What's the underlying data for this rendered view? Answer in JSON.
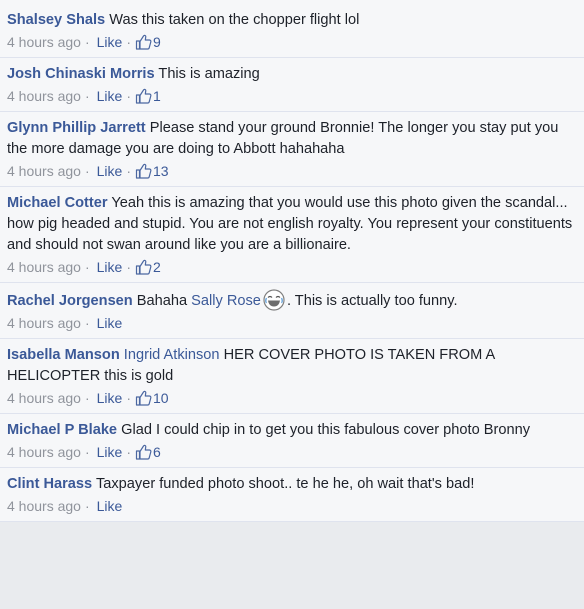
{
  "colors": {
    "link": "#3b5998",
    "meta": "#90949c",
    "background": "#f6f7f9"
  },
  "comments": [
    {
      "author": "Shalsey Shals",
      "text": "Was this taken on the chopper flight lol",
      "time": "4 hours ago",
      "like": "Like",
      "likes": "9"
    },
    {
      "author": "Josh Chinaski Morris",
      "text": "This is amazing",
      "time": "4 hours ago",
      "like": "Like",
      "likes": "1"
    },
    {
      "author": "Glynn Phillip Jarrett",
      "text": "Please stand your ground Bronnie! The longer you stay put you the more damage you are doing to Abbott hahahaha",
      "time": "4 hours ago",
      "like": "Like",
      "likes": "13"
    },
    {
      "author": "Michael Cotter",
      "text": "Yeah this is amazing that you would use this photo given the scandal... how pig headed and stupid. You are not english royalty. You represent your constituents and should not swan around like you are a billionaire.",
      "time": "4 hours ago",
      "like": "Like",
      "likes": "2"
    },
    {
      "author": "Rachel Jorgensen",
      "text": "Bahaha",
      "mention": "Sally Rose",
      "emoji": "laughing-emoji",
      "trail": ". This is actually too funny.",
      "time": "4 hours ago",
      "like": "Like"
    },
    {
      "author": "Isabella Manson",
      "mention": "Ingrid Atkinson",
      "text": "HER COVER PHOTO IS TAKEN FROM A HELICOPTER this is gold",
      "time": "4 hours ago",
      "like": "Like",
      "likes": "10"
    },
    {
      "author": "Michael P Blake",
      "text": "Glad I could chip in to get you this fabulous cover photo Bronny",
      "time": "4 hours ago",
      "like": "Like",
      "likes": "6"
    },
    {
      "author": "Clint Harass",
      "text": "Taxpayer funded photo shoot.. te he he, oh wait that's bad!",
      "time": "4 hours ago",
      "like": "Like"
    }
  ]
}
